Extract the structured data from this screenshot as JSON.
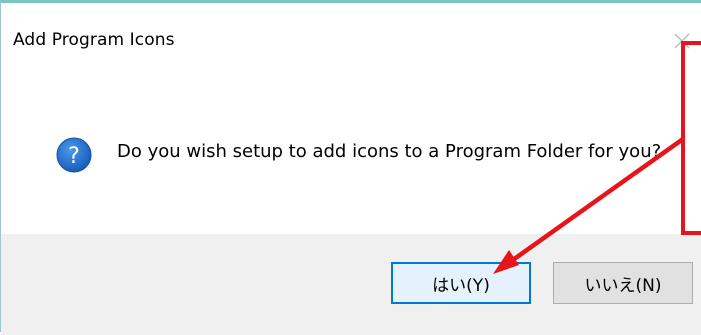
{
  "dialog": {
    "title": "Add Program Icons",
    "message": "Do you wish setup to add icons to a Program Folder for you?",
    "icon": "question-icon",
    "close_icon": "close-icon"
  },
  "buttons": {
    "yes_label": "はい(Y)",
    "no_label": "いいえ(N)"
  },
  "annotation": {
    "color": "#e8141b",
    "type": "highlight-box-with-arrow"
  },
  "colors": {
    "accent": "#0078d7",
    "footer_bg": "#f0f0f0",
    "question_icon": "#1f6fc7"
  }
}
